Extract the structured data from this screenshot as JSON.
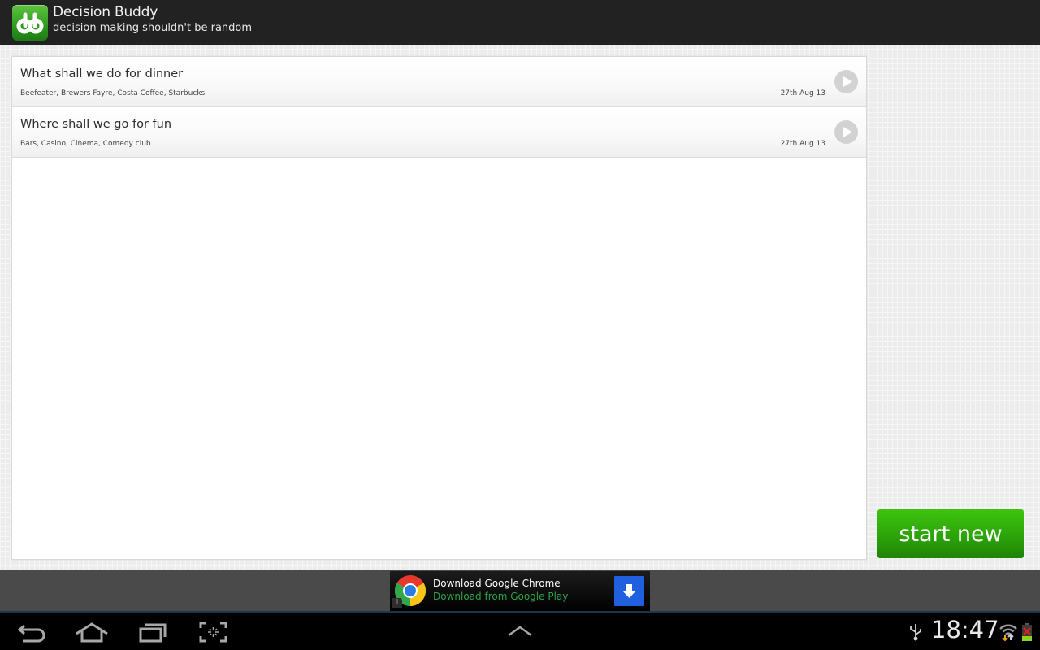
{
  "app": {
    "title": "Decision Buddy",
    "subtitle": "decision making shouldn't be random",
    "logo_icon": "db-logo-icon",
    "logo_text": "db"
  },
  "decisions": [
    {
      "title": "What shall we do for dinner",
      "options": "Beefeater, Brewers Fayre, Costa Coffee, Starbucks",
      "date": "27th Aug 13",
      "action_icon": "play-icon"
    },
    {
      "title": "Where shall we go for fun",
      "options": "Bars, Casino, Cinema, Comedy club",
      "date": "27th Aug 13",
      "action_icon": "play-icon"
    }
  ],
  "start_button": {
    "label": "start new",
    "color": "#2ea70a"
  },
  "ad": {
    "title": "Download Google Chrome",
    "subtitle": "Download from Google Play",
    "info_label": "i",
    "icon": "chrome-logo-icon",
    "action_icon": "download-arrow-icon"
  },
  "system_bar": {
    "nav_icons": [
      "back-icon",
      "home-icon",
      "recent-apps-icon",
      "screenshot-icon",
      "chevron-up-icon"
    ],
    "clock": "18:47",
    "status_icons": [
      "usb-icon",
      "wifi-icon",
      "battery-icon"
    ]
  }
}
